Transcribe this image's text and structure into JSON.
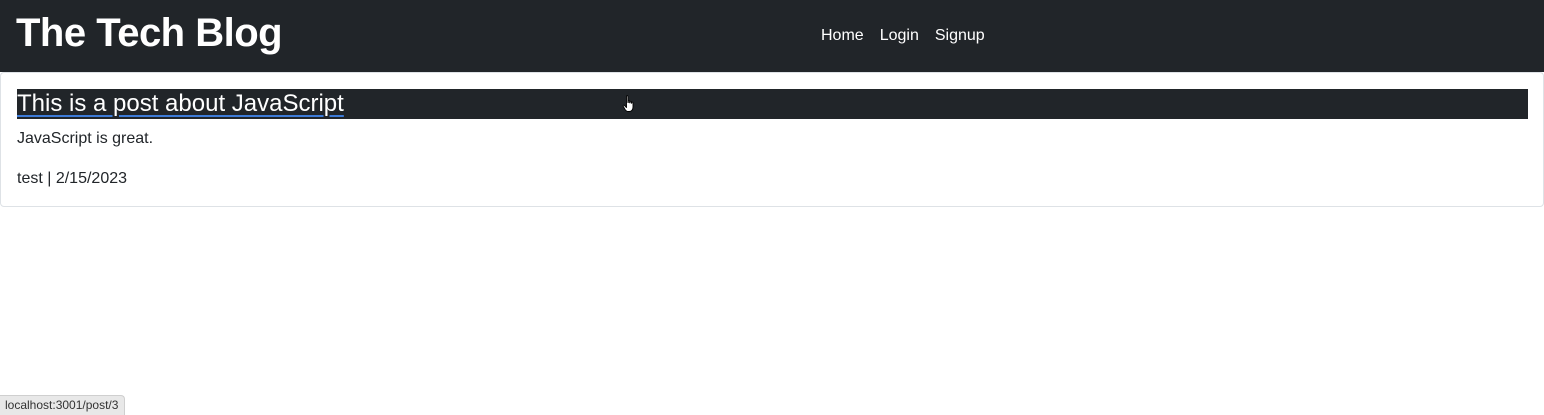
{
  "navbar": {
    "brand": "The Tech Blog",
    "links": [
      {
        "label": "Home"
      },
      {
        "label": "Login"
      },
      {
        "label": "Signup"
      }
    ]
  },
  "post": {
    "title": "This is a post about JavaScript",
    "body": "JavaScript is great.",
    "meta": "test | 2/15/2023"
  },
  "status_bar": {
    "url": "localhost:3001/post/3"
  },
  "cursor": {
    "icon": "hand-pointer-icon"
  },
  "colors": {
    "navbar_bg": "#212529",
    "link_underline": "#3d7bd8"
  }
}
